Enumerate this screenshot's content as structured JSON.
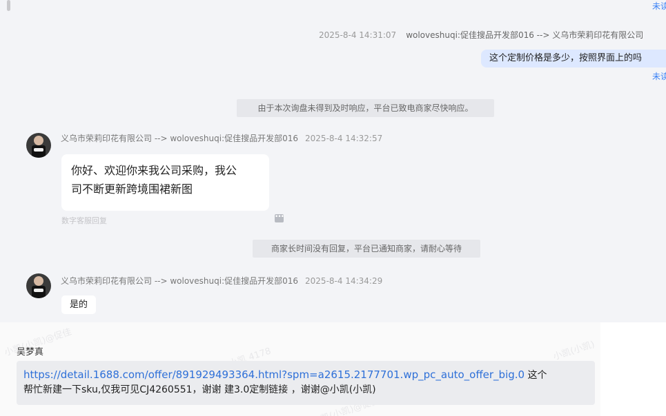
{
  "status_label": "未读",
  "messages": {
    "outgoing": {
      "time": "2025-8-4 14:31:07",
      "sender": "woloveshuqi:促佳搜品开发部016 --> 义乌市荣莉印花有限公司",
      "text": "这个定制价格是多少，按照界面上的吗"
    },
    "system_1": "由于本次询盘未得到及时响应，平台已致电商家尽快响应。",
    "incoming_1": {
      "sender": "义乌市荣莉印花有限公司 --> woloveshuqi:促佳搜品开发部016",
      "time": "2025-8-4 14:32:57",
      "line1": "你好、欢迎你来我公司采购，我公",
      "line2": "司不断更新跨境围裙新图",
      "note": "数字客服回复",
      "more_icon": "more-icon"
    },
    "system_2": "商家长时间没有回复，平台已通知商家，请耐心等待",
    "incoming_2": {
      "sender": "义乌市荣莉印花有限公司 --> woloveshuqi:促佳搜品开发部016",
      "time": "2025-8-4 14:34:29",
      "text": "是的"
    }
  },
  "quote": {
    "author": "吴梦真",
    "link": "https://detail.1688.com/offer/891929493364.html?spm=a2615.2177701.wp_pc_auto_offer_big.0",
    "text_after_link": " 这个",
    "line2": "帮忙新建一下sku,仅我可见CJ4260551，谢谢 建3.0定制链接 ，谢谢@小凯(小凯)"
  },
  "colors": {
    "outgoing_bubble": "#dde8ff",
    "link": "#2d6fd8",
    "status": "#3b82f6"
  }
}
